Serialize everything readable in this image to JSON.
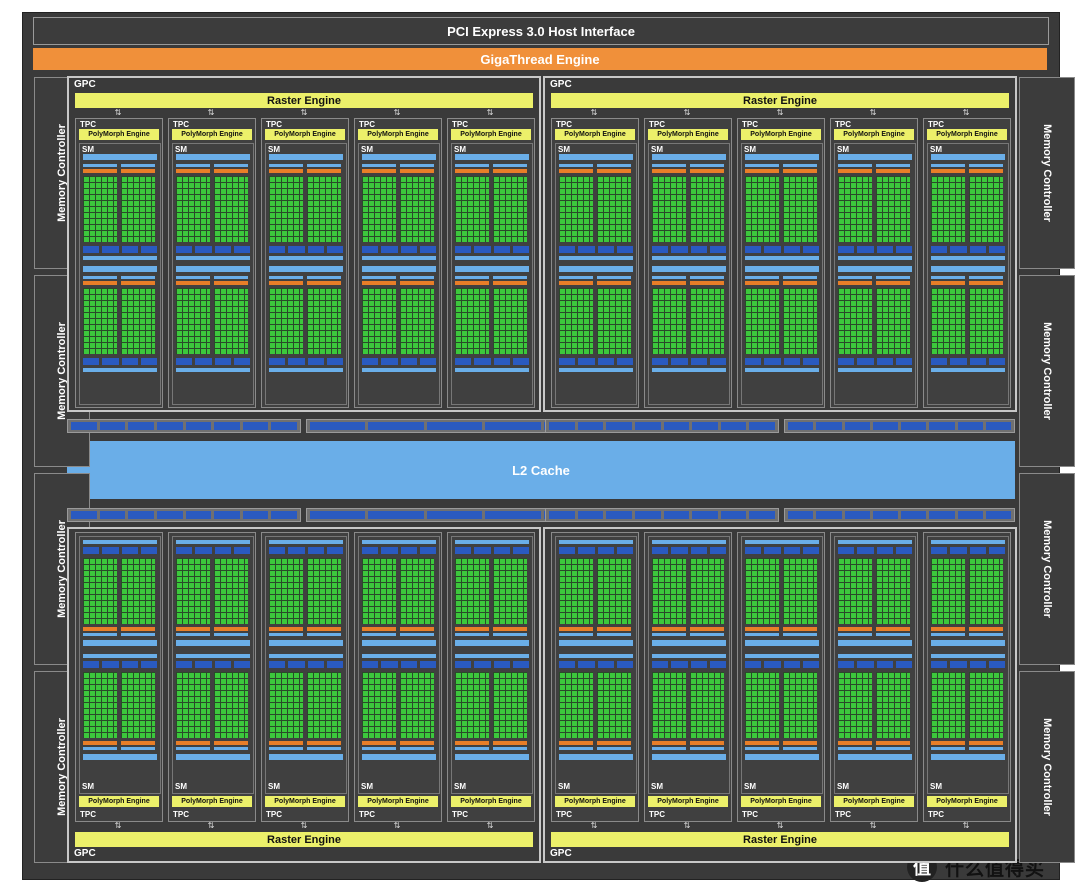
{
  "pcie": "PCI Express 3.0 Host Interface",
  "giga": "GigaThread Engine",
  "memory_controller": "Memory Controller",
  "l2": "L2 Cache",
  "gpc_label": "GPC",
  "raster_label": "Raster Engine",
  "tpc_label": "TPC",
  "poly_label": "PolyMorph Engine",
  "sm_label": "SM",
  "arrow_glyph": "⇅",
  "logo": {
    "mark": "值",
    "text": "什么值得买"
  },
  "colors": {
    "chip_bg": "#3a3a3a",
    "giga_orange": "#f0903a",
    "raster_yellow": "#ecf06a",
    "l2_blue": "#6aaee8",
    "cuda_green": "#3cc83c",
    "tex_blue": "#2a5ac0"
  }
}
